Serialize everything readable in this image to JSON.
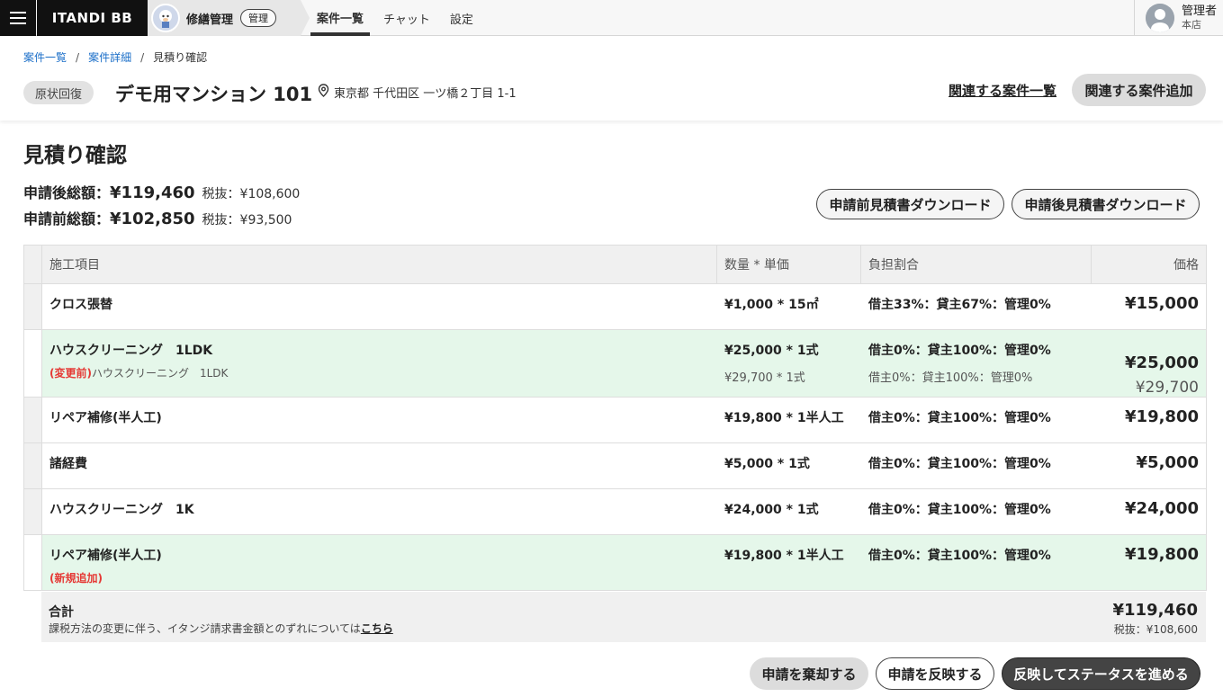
{
  "topbar": {
    "brand": "ITANDI BB",
    "app_name": "修繕管理",
    "app_badge": "管理",
    "tabs": [
      {
        "label": "案件一覧",
        "active": true
      },
      {
        "label": "チャット",
        "active": false
      },
      {
        "label": "設定",
        "active": false
      }
    ],
    "user": {
      "name": "管理者",
      "branch": "本店"
    }
  },
  "breadcrumb": {
    "items": [
      "案件一覧",
      "案件詳細"
    ],
    "current": "見積り確認"
  },
  "property": {
    "category": "原状回復",
    "name": "デモ用マンション 101",
    "address": "東京都 千代田区 一ツ橋２丁目 1-1"
  },
  "header_actions": {
    "related_list": "関連する案件一覧",
    "related_add": "関連する案件追加"
  },
  "page_title": "見積り確認",
  "totals": {
    "after_label": "申請後総額：",
    "after_amount": "¥119,460",
    "after_tax": "税抜：¥108,600",
    "before_label": "申請前総額：",
    "before_amount": "¥102,850",
    "before_tax": "税抜：¥93,500"
  },
  "downloads": {
    "before": "申請前見積書ダウンロード",
    "after": "申請後見積書ダウンロード"
  },
  "table": {
    "headers": {
      "item": "施工項目",
      "qty": "数量 * 単価",
      "ratio": "負担割合",
      "price": "価格"
    },
    "rows": [
      {
        "item": "クロス張替",
        "qty": "¥1,000 * 15㎡",
        "ratio": "借主33%：貸主67%：管理0%",
        "price": "¥15,000"
      },
      {
        "item": "ハウスクリーニング　1LDK",
        "change_label": "(変更前)",
        "prev_item": "ハウスクリーニング　1LDK",
        "qty": "¥25,000 * 1式",
        "prev_qty": "¥29,700 * 1式",
        "ratio": "借主0%：貸主100%：管理0%",
        "prev_ratio": "借主0%：貸主100%：管理0%",
        "price": "¥25,000",
        "prev_price": "¥29,700"
      },
      {
        "item": "リペア補修(半人工)",
        "qty": "¥19,800 * 1半人工",
        "ratio": "借主0%：貸主100%：管理0%",
        "price": "¥19,800"
      },
      {
        "item": "諸経費",
        "qty": "¥5,000 * 1式",
        "ratio": "借主0%：貸主100%：管理0%",
        "price": "¥5,000"
      },
      {
        "item": "ハウスクリーニング　1K",
        "qty": "¥24,000 * 1式",
        "ratio": "借主0%：貸主100%：管理0%",
        "price": "¥24,000"
      },
      {
        "item": "リペア補修(半人工)",
        "new_label": "(新規追加)",
        "qty": "¥19,800 * 1半人工",
        "ratio": "借主0%：貸主100%：管理0%",
        "price": "¥19,800"
      }
    ],
    "summary": {
      "label": "合計",
      "note": "課税方法の変更に伴う、イタンジ請求書金額とのずれについては",
      "note_link": "こちら",
      "total": "¥119,460",
      "tax": "税抜：¥108,600"
    }
  },
  "footer": {
    "reject": "申請を棄却する",
    "apply": "申請を反映する",
    "advance": "反映してステータスを進める"
  },
  "colors": {
    "accent_dark": "#444444",
    "changed_row_bg": "#e5f7ea",
    "change_label": "#e53935",
    "link": "#1a6ec8"
  }
}
